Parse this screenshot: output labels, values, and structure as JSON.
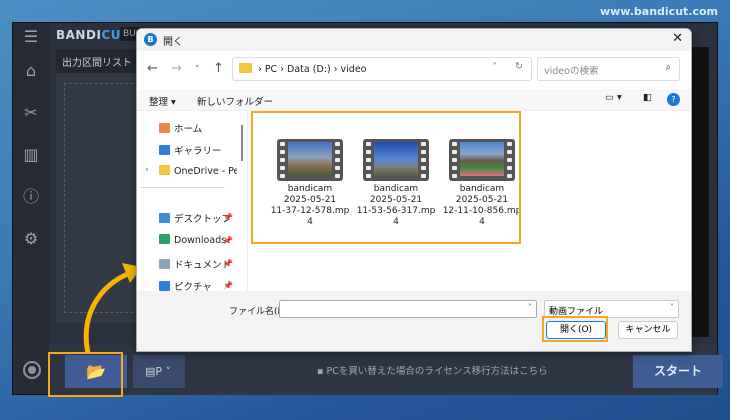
{
  "site_url": "www.bandicut.com",
  "app": {
    "logo_a": "BANDI",
    "logo_b": "CUT",
    "edition": "BUS",
    "list_header": "出力区間リスト",
    "message": "PCを買い替えた場合のライセンス移行方法はこちら",
    "start_label": "スタート",
    "format_label": "P"
  },
  "dialog": {
    "title": "開く",
    "breadcrumb": [
      "PC",
      "Data (D:)",
      "video"
    ],
    "search_placeholder": "videoの検索",
    "organize": "整理 ▾",
    "new_folder": "新しいフォルダー",
    "nav": [
      {
        "label": "ホーム",
        "color": "#e8894a"
      },
      {
        "label": "ギャラリー",
        "color": "#2f7fd6"
      },
      {
        "label": "OneDrive - Perso",
        "color": "#f4c542"
      },
      {
        "label": "デスクトップ",
        "color": "#3d8fd6"
      },
      {
        "label": "Downloads",
        "color": "#2aa36b"
      },
      {
        "label": "ドキュメント",
        "color": "#8fa3b8"
      },
      {
        "label": "ピクチャ",
        "color": "#2f7fd6"
      }
    ],
    "files": [
      {
        "name": [
          "bandicam",
          "2025-05-21",
          "11-37-12-578.mp",
          "4"
        ]
      },
      {
        "name": [
          "bandicam",
          "2025-05-21",
          "11-53-56-317.mp",
          "4"
        ]
      },
      {
        "name": [
          "bandicam",
          "2025-05-21",
          "12-11-10-856.mp",
          "4"
        ]
      }
    ],
    "filename_label": "ファイル名(N):",
    "filename_value": "",
    "filetype": "動画ファイル",
    "open_label": "開く(O)",
    "cancel_label": "キャンセル"
  },
  "colors": {
    "accent": "#3f5d94",
    "highlight": "#f5a623"
  }
}
